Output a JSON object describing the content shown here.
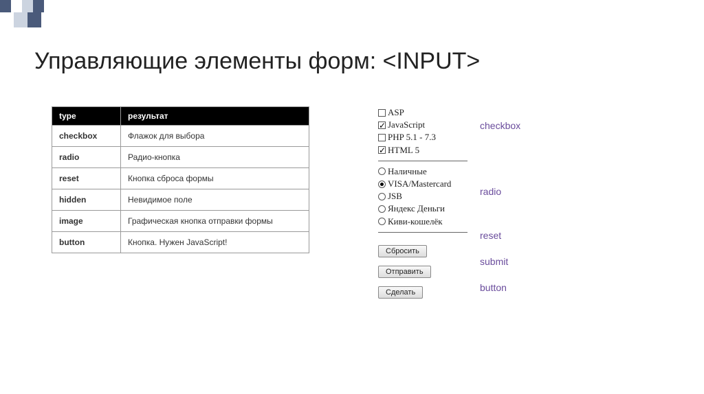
{
  "title": "Управляющие элементы форм: <INPUT>",
  "table": {
    "headers": [
      "type",
      "результат"
    ],
    "rows": [
      {
        "type": "checkbox",
        "desc": "Флажок для выбора"
      },
      {
        "type": "radio",
        "desc": "Радио-кнопка"
      },
      {
        "type": "reset",
        "desc": "Кнопка сброса формы"
      },
      {
        "type": "hidden",
        "desc": "Невидимое поле"
      },
      {
        "type": "image",
        "desc": "Графическая кнопка отправки формы"
      },
      {
        "type": "button",
        "desc": "Кнопка. Нужен JavaScript!"
      }
    ]
  },
  "demo": {
    "checkboxes": [
      {
        "label": "ASP",
        "checked": false
      },
      {
        "label": "JavaScript",
        "checked": true
      },
      {
        "label": "PHP 5.1 - 7.3",
        "checked": false
      },
      {
        "label": "HTML 5",
        "checked": true
      }
    ],
    "radios": [
      {
        "label": "Наличные",
        "checked": false
      },
      {
        "label": "VISA/Mastercard",
        "checked": true
      },
      {
        "label": "JSB",
        "checked": false
      },
      {
        "label": "Яндекс Деньги",
        "checked": false
      },
      {
        "label": "Киви-кошелёк",
        "checked": false
      }
    ],
    "reset_btn": "Сбросить",
    "submit_btn": "Отправить",
    "button_btn": "Сделать"
  },
  "labels": {
    "checkbox": "checkbox",
    "radio": "radio",
    "reset": "reset",
    "submit": "submit",
    "button": "button"
  }
}
